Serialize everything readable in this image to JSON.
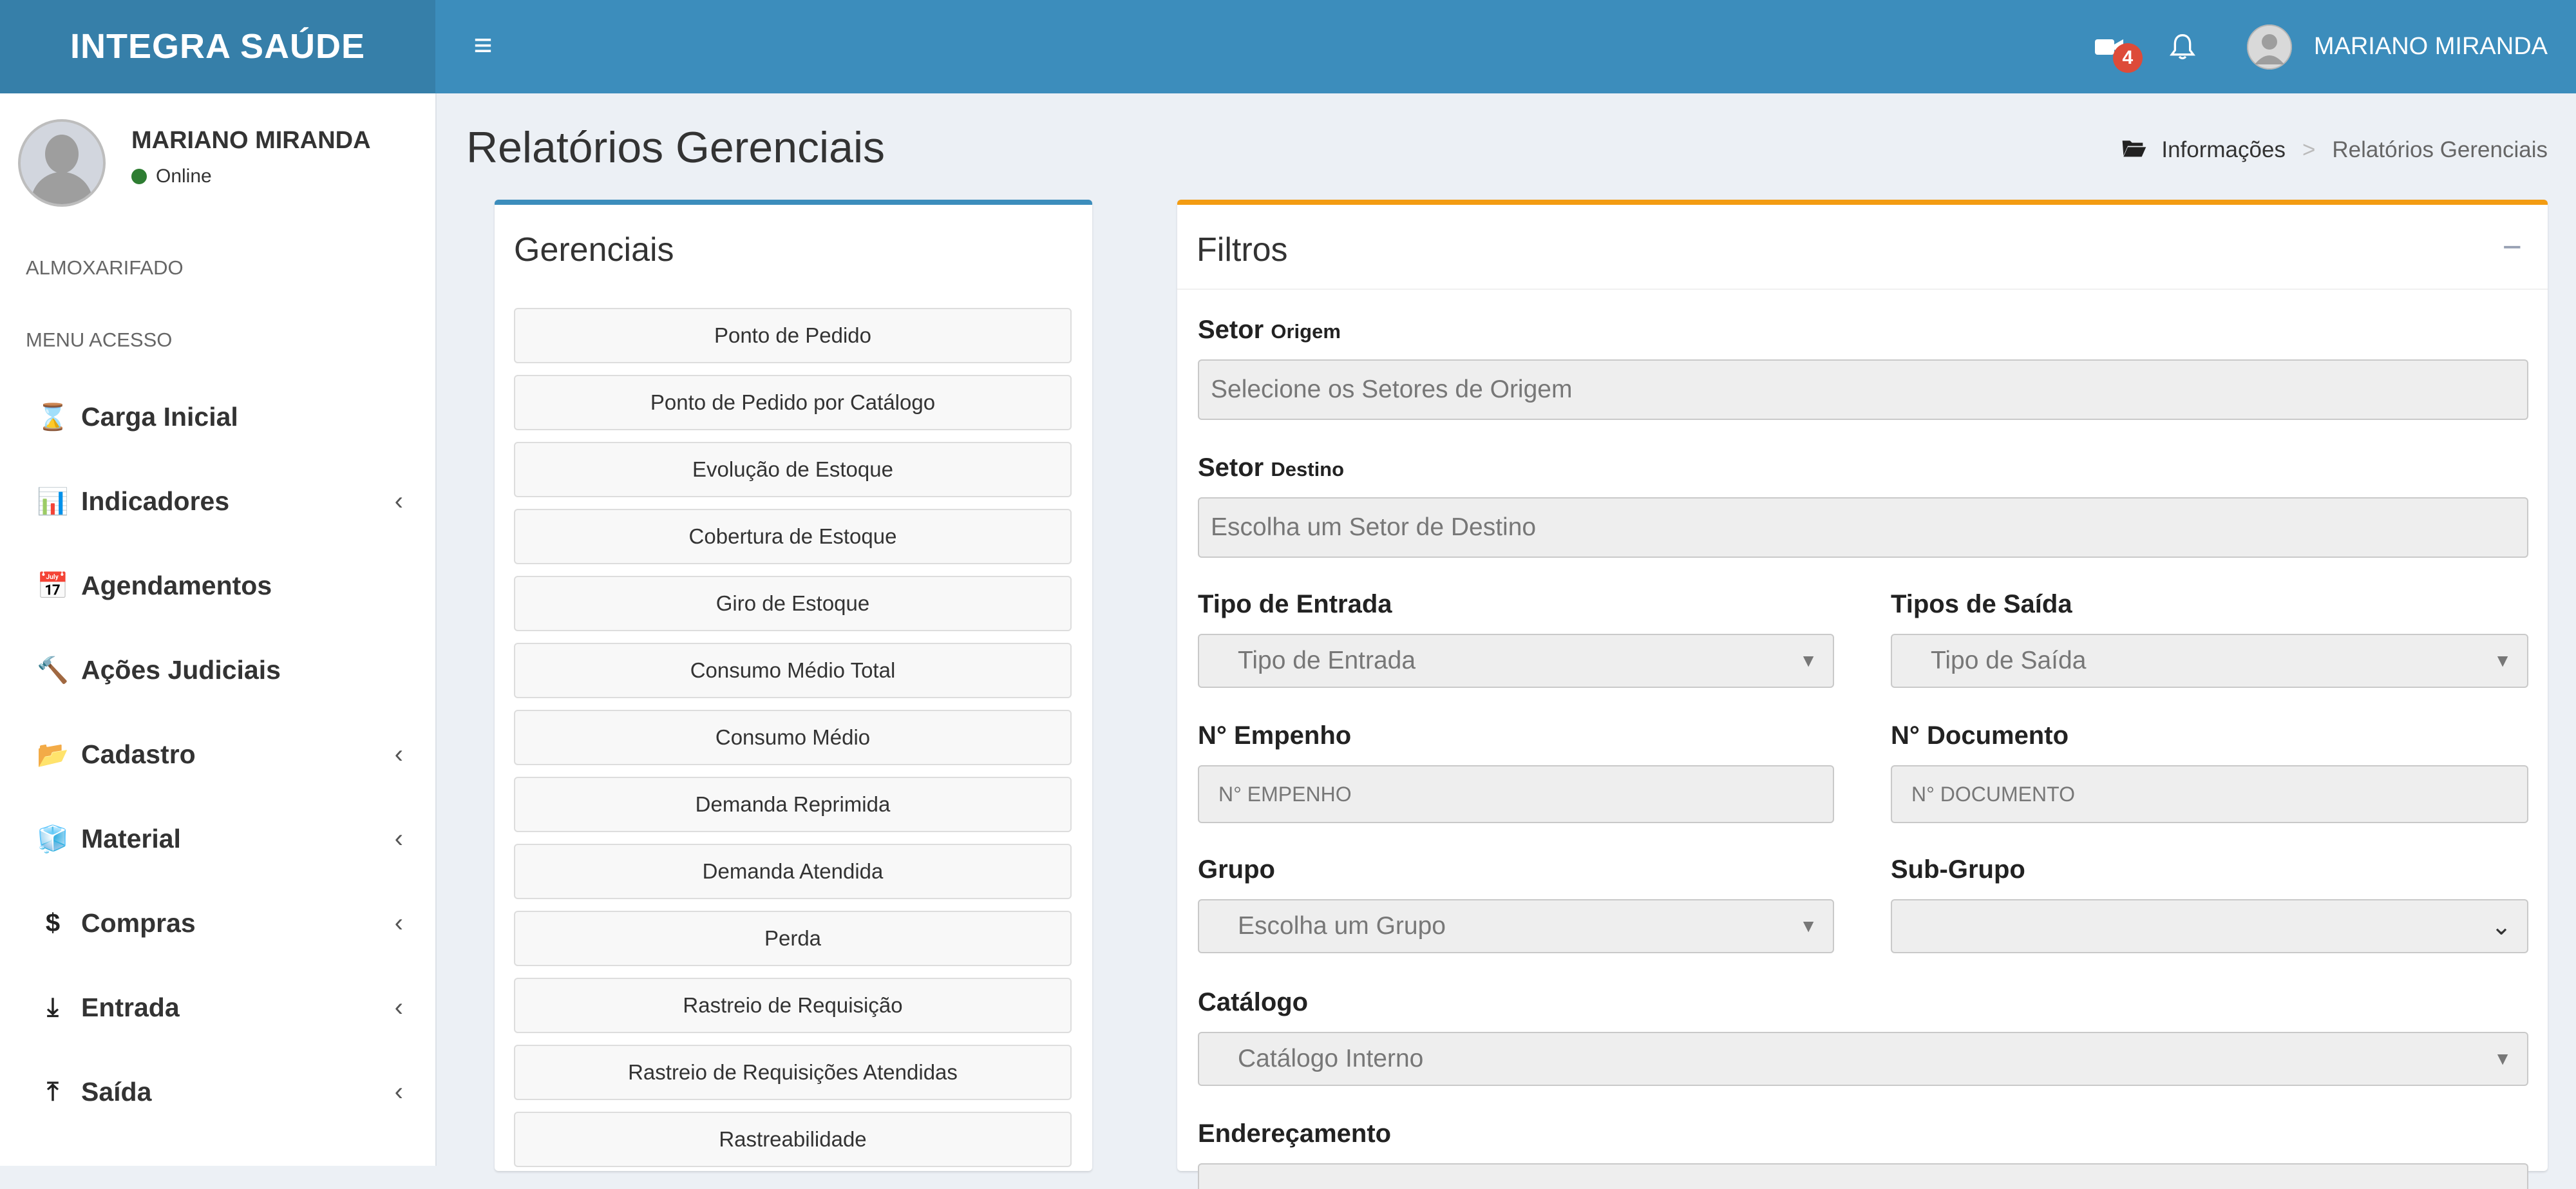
{
  "app": {
    "brand": "INTEGRA SAÚDE",
    "colors": {
      "topbar": "#3c8dbc",
      "brand_bg": "#367fa9",
      "primary_border": "#3c8dbc",
      "warning_border": "#f39c12",
      "badge": "#dd4b39",
      "online": "#2e7d32"
    }
  },
  "topbar": {
    "hamburger_icon": "≡",
    "video_icon": "video-camera-icon",
    "video_badge": "4",
    "bell_icon": "bell-icon",
    "user_name": "MARIANO MIRANDA"
  },
  "sidebar": {
    "user_name": "MARIANO MIRANDA",
    "status": "Online",
    "section_1": "ALMOXARIFADO",
    "section_2": "MENU ACESSO",
    "items": [
      {
        "icon": "⌛",
        "label": "Carga Inicial",
        "chevron": ""
      },
      {
        "icon": "📊",
        "label": "Indicadores",
        "chevron": "‹"
      },
      {
        "icon": "📅",
        "label": "Agendamentos",
        "chevron": ""
      },
      {
        "icon": "🔨",
        "label": "Ações Judiciais",
        "chevron": ""
      },
      {
        "icon": "📂",
        "label": "Cadastro",
        "chevron": "‹"
      },
      {
        "icon": "🧊",
        "label": "Material",
        "chevron": "‹"
      },
      {
        "icon": "$",
        "label": "Compras",
        "chevron": "‹"
      },
      {
        "icon": "⤓",
        "label": "Entrada",
        "chevron": "‹"
      },
      {
        "icon": "⤒",
        "label": "Saída",
        "chevron": "‹"
      }
    ]
  },
  "page": {
    "title": "Relatórios Gerenciais",
    "breadcrumb": {
      "home": "Informações",
      "separator": ">",
      "current": "Relatórios Gerenciais"
    }
  },
  "gerenciais": {
    "title": "Gerenciais",
    "buttons": [
      "Ponto de Pedido",
      "Ponto de Pedido por Catálogo",
      "Evolução de Estoque",
      "Cobertura de Estoque",
      "Giro de Estoque",
      "Consumo Médio Total",
      "Consumo Médio",
      "Demanda Reprimida",
      "Demanda Atendida",
      "Perda",
      "Rastreio de Requisição",
      "Rastreio de Requisições Atendidas",
      "Rastreabilidade"
    ]
  },
  "filtros": {
    "title": "Filtros",
    "collapse": "−",
    "setor_origem": {
      "label": "Setor",
      "label_small": "Origem",
      "placeholder": "Selecione os Setores de Origem"
    },
    "setor_destino": {
      "label": "Setor",
      "label_small": "Destino",
      "placeholder": "Escolha um Setor de Destino"
    },
    "tipo_entrada": {
      "label": "Tipo de Entrada",
      "value": "Tipo de Entrada"
    },
    "tipos_saida": {
      "label": "Tipos de Saída",
      "value": "Tipo de Saída"
    },
    "empenho": {
      "label": "N° Empenho",
      "placeholder": "N° EMPENHO"
    },
    "documento": {
      "label": "N° Documento",
      "placeholder": "N° DOCUMENTO"
    },
    "grupo": {
      "label": "Grupo",
      "value": "Escolha um Grupo"
    },
    "sub_grupo": {
      "label": "Sub-Grupo",
      "value": ""
    },
    "catalogo": {
      "label": "Catálogo",
      "value": "Catálogo Interno"
    },
    "enderecamento": {
      "label": "Endereçamento"
    }
  }
}
